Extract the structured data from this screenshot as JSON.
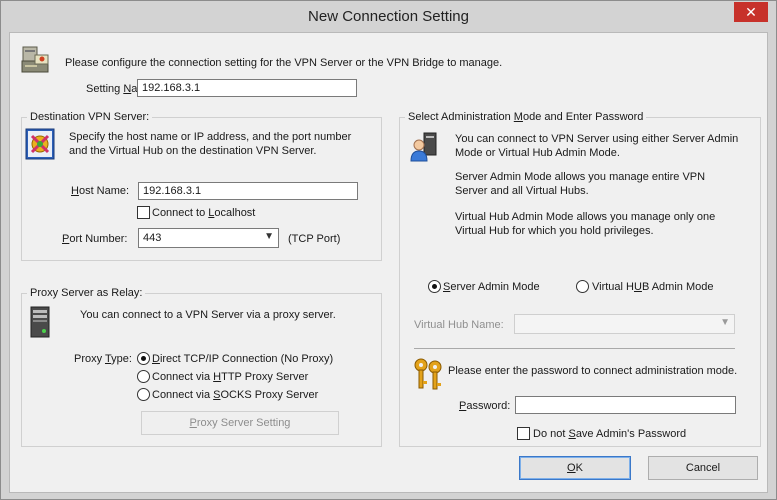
{
  "window": {
    "title": "New Connection Setting",
    "close_label": "✕"
  },
  "intro": {
    "text": "Please configure the connection setting for the VPN Server or the VPN Bridge to manage."
  },
  "setting_name": {
    "label_pre": "Setting ",
    "label_key": "N",
    "label_post": "ame:",
    "value": "192.168.3.1"
  },
  "destination": {
    "title": "Destination VPN Server:",
    "desc_line1": "Specify the host name or IP address, and the port number",
    "desc_line2": "and the Virtual Hub on the destination VPN Server.",
    "host_label_key": "H",
    "host_label_post": "ost Name:",
    "host_value": "192.168.3.1",
    "localhost_pre": "Connect to ",
    "localhost_key": "L",
    "localhost_post": "ocalhost",
    "port_label_key": "P",
    "port_label_post": "ort Number:",
    "port_value": "443",
    "port_hint": "(TCP Port)"
  },
  "proxy": {
    "title": "Proxy Server as Relay:",
    "desc": "You can connect to a VPN Server via a proxy server.",
    "type_label_pre": "Proxy ",
    "type_label_key": "T",
    "type_label_post": "ype:",
    "opt_direct_key": "D",
    "opt_direct_post": "irect TCP/IP Connection (No Proxy)",
    "opt_http_pre": "Connect via ",
    "opt_http_key": "H",
    "opt_http_post": "TTP Proxy Server",
    "opt_socks_pre": "Connect via ",
    "opt_socks_key": "S",
    "opt_socks_post": "OCKS Proxy Server",
    "setting_button_pre": "",
    "setting_button_key": "P",
    "setting_button_post": "roxy Server Setting"
  },
  "admin": {
    "title_pre": "Select Administration ",
    "title_key": "M",
    "title_post": "ode and Enter Password",
    "p1_line1": "You can connect to VPN Server using either Server Admin",
    "p1_line2": "Mode or Virtual Hub Admin Mode.",
    "p2_line1": "Server Admin Mode allows you manage entire VPN",
    "p2_line2": "Server and all Virtual Hubs.",
    "p3_line1": "Virtual Hub Admin Mode allows you manage only one",
    "p3_line2": "Virtual Hub for which you hold privileges.",
    "server_mode_key": "S",
    "server_mode_post": "erver Admin Mode",
    "hub_mode_pre": "Virtual H",
    "hub_mode_key": "U",
    "hub_mode_post": "B Admin Mode",
    "hub_name_label": "Virtual Hub Name:",
    "hub_name_value": "",
    "password_prompt": "Please enter the password to connect administration mode.",
    "password_label_key": "P",
    "password_label_post": "assword:",
    "password_value": "",
    "nosave_pre": "Do not ",
    "nosave_key": "S",
    "nosave_post": "ave Admin's Password"
  },
  "footer": {
    "ok_key": "O",
    "ok_post": "K",
    "cancel_label": "Cancel"
  },
  "colors": {
    "default_button_border": "#3b78c9",
    "close_button": "#c7312a"
  }
}
